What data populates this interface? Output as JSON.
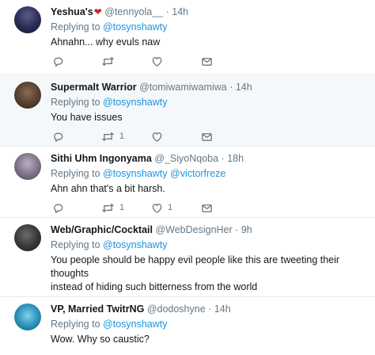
{
  "tweets": [
    {
      "name": "Yeshua's",
      "handle": "@tennyola__",
      "sep": "·",
      "time": "14h",
      "replying_prefix": "Replying to",
      "mentions": [
        "@tosynshawty"
      ],
      "text_lines": [
        "Ahnahn... why evuls naw"
      ],
      "retweet_count": "",
      "like_count": ""
    },
    {
      "name": "Supermalt Warrior",
      "handle": "@tomiwamiwamiwa",
      "sep": "·",
      "time": "14h",
      "replying_prefix": "Replying to",
      "mentions": [
        "@tosynshawty"
      ],
      "text_lines": [
        "You have issues"
      ],
      "retweet_count": "1",
      "like_count": ""
    },
    {
      "name": "Sithi Uhm Ingonyama",
      "handle": "@_SiyoNqoba",
      "sep": "·",
      "time": "18h",
      "replying_prefix": "Replying to",
      "mentions": [
        "@tosynshawty",
        "@victorfreze"
      ],
      "text_lines": [
        "Ahn ahn that's a bit harsh."
      ],
      "retweet_count": "1",
      "like_count": "1"
    },
    {
      "name": "Web/Graphic/Cocktail",
      "handle": "@WebDesignHer",
      "sep": "·",
      "time": "9h",
      "replying_prefix": "Replying to",
      "mentions": [
        "@tosynshawty"
      ],
      "text_lines": [
        "You people should be happy evil people like this are tweeting their thoughts",
        "instead of hiding such bitterness from the world"
      ],
      "retweet_count": "",
      "like_count": ""
    },
    {
      "name": "VP, Married TwitrNG",
      "handle": "@dodoshyne",
      "sep": "·",
      "time": "14h",
      "replying_prefix": "Replying to",
      "mentions": [
        "@tosynshawty"
      ],
      "text_lines": [
        "Wow. Why so caustic?"
      ],
      "retweet_count": "",
      "like_count": ""
    }
  ],
  "icons": {
    "reply": "reply-icon",
    "retweet": "retweet-icon",
    "like": "heart-icon",
    "dm": "envelope-icon",
    "name_heart": "red-heart-icon"
  },
  "colors": {
    "link": "#1b95e0",
    "muted": "#657786",
    "highlight_bg": "#f5f8fa",
    "divider": "#e6ecf0"
  }
}
